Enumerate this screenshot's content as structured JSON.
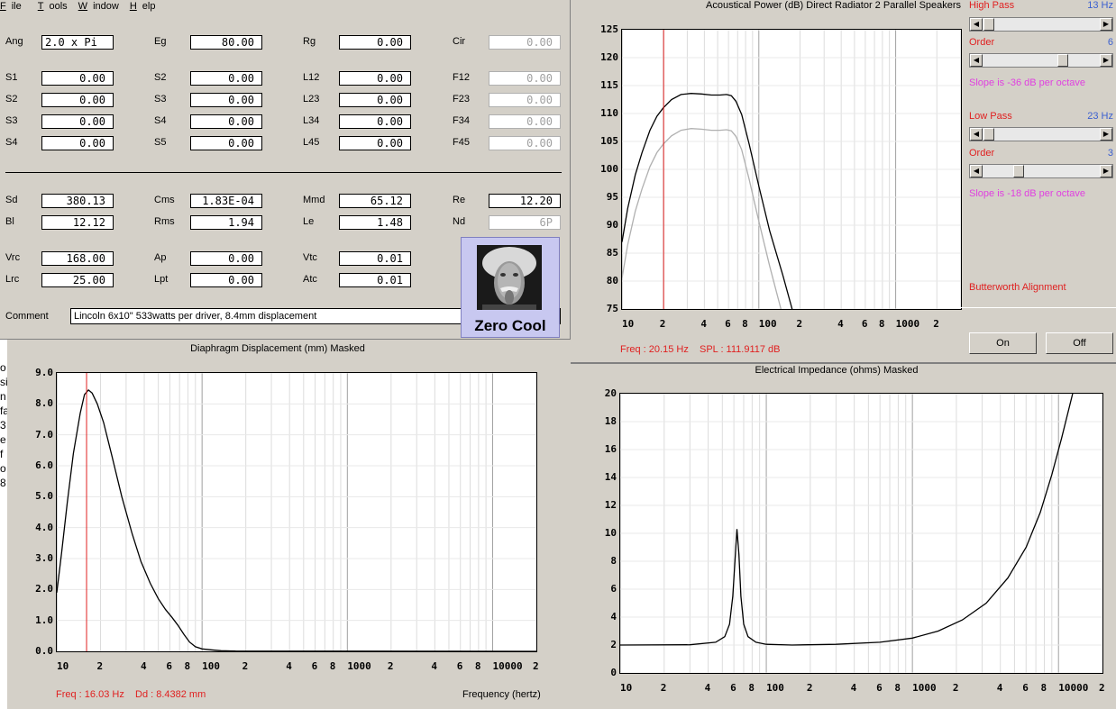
{
  "menu": [
    "File",
    "Tools",
    "Window",
    "Help"
  ],
  "params": {
    "ang": {
      "label": "Ang",
      "value": "2.0 x Pi"
    },
    "eg": {
      "label": "Eg",
      "value": "80.00"
    },
    "rg": {
      "label": "Rg",
      "value": "0.00"
    },
    "cir": {
      "label": "Cir",
      "value": "0.00"
    },
    "s1a": {
      "label": "S1",
      "value": "0.00"
    },
    "s2a": {
      "label": "S2",
      "value": "0.00"
    },
    "l12": {
      "label": "L12",
      "value": "0.00"
    },
    "f12": {
      "label": "F12",
      "value": "0.00"
    },
    "s2b": {
      "label": "S2",
      "value": "0.00"
    },
    "s3a": {
      "label": "S3",
      "value": "0.00"
    },
    "l23": {
      "label": "L23",
      "value": "0.00"
    },
    "f23": {
      "label": "F23",
      "value": "0.00"
    },
    "s3b": {
      "label": "S3",
      "value": "0.00"
    },
    "s4a": {
      "label": "S4",
      "value": "0.00"
    },
    "l34": {
      "label": "L34",
      "value": "0.00"
    },
    "f34": {
      "label": "F34",
      "value": "0.00"
    },
    "s4b": {
      "label": "S4",
      "value": "0.00"
    },
    "s5a": {
      "label": "S5",
      "value": "0.00"
    },
    "l45": {
      "label": "L45",
      "value": "0.00"
    },
    "f45": {
      "label": "F45",
      "value": "0.00"
    },
    "sd": {
      "label": "Sd",
      "value": "380.13"
    },
    "cms": {
      "label": "Cms",
      "value": "1.83E-04"
    },
    "mmd": {
      "label": "Mmd",
      "value": "65.12"
    },
    "re": {
      "label": "Re",
      "value": "12.20"
    },
    "bl": {
      "label": "Bl",
      "value": "12.12"
    },
    "rms": {
      "label": "Rms",
      "value": "1.94"
    },
    "le": {
      "label": "Le",
      "value": "1.48"
    },
    "nd": {
      "label": "Nd",
      "value": "6P"
    },
    "vrc": {
      "label": "Vrc",
      "value": "168.00"
    },
    "ap": {
      "label": "Ap",
      "value": "0.00"
    },
    "vtc": {
      "label": "Vtc",
      "value": "0.01"
    },
    "lrc": {
      "label": "Lrc",
      "value": "25.00"
    },
    "lpt": {
      "label": "Lpt",
      "value": "0.00"
    },
    "atc": {
      "label": "Atc",
      "value": "0.01"
    },
    "comment": {
      "label": "Comment",
      "value": "Lincoln  6x10\" 533watts per driver, 8.4mm displacement"
    }
  },
  "badge": {
    "caption": "Zero Cool"
  },
  "filters": {
    "high_pass": {
      "label": "High Pass",
      "value": "13 Hz",
      "order_label": "Order",
      "order": "6",
      "slope": "Slope is -36 dB per octave"
    },
    "low_pass": {
      "label": "Low Pass",
      "value": "23 Hz",
      "order_label": "Order",
      "order": "3",
      "slope": "Slope is -18 dB per octave"
    },
    "alignment": "Butterworth Alignment",
    "on": "On",
    "off": "Off"
  },
  "colors": {
    "red": "#e02020",
    "blue": "#3a5fd0",
    "magenta": "#e040e0"
  },
  "left_partial_text": [
    "o",
    "si",
    "n",
    "fa",
    "3",
    "e",
    "f",
    "o",
    "8"
  ],
  "chart_data": [
    {
      "id": "spl",
      "type": "line",
      "title": "Acoustical Power (dB)   Direct Radiator   2 Parallel Speakers",
      "xscale": "log",
      "xlim": [
        10,
        3000
      ],
      "ylim": [
        75,
        125
      ],
      "yticks": [
        75,
        80,
        85,
        90,
        95,
        100,
        105,
        110,
        115,
        120,
        125
      ],
      "xtick_labels": [
        "10",
        "2",
        "4",
        "6",
        "8",
        "100",
        "2",
        "4",
        "6",
        "8",
        "1000",
        "2"
      ],
      "marker_x": 20.15,
      "readout": {
        "freq": "Freq : 20.15 Hz",
        "value": "SPL : 111.9117 dB"
      },
      "series": [
        {
          "color": "#000000",
          "points": [
            [
              10,
              87
            ],
            [
              11,
              93
            ],
            [
              12.5,
              99
            ],
            [
              14,
              103
            ],
            [
              16,
              107
            ],
            [
              18,
              109.5
            ],
            [
              20,
              111
            ],
            [
              23,
              112.5
            ],
            [
              27,
              113.4
            ],
            [
              32,
              113.6
            ],
            [
              38,
              113.5
            ],
            [
              45,
              113.3
            ],
            [
              52,
              113.3
            ],
            [
              58,
              113.4
            ],
            [
              63,
              113.2
            ],
            [
              68,
              112.2
            ],
            [
              75,
              109.8
            ],
            [
              85,
              104.5
            ],
            [
              100,
              97
            ],
            [
              120,
              89
            ],
            [
              150,
              81
            ],
            [
              175,
              75
            ]
          ]
        },
        {
          "color": "#b0b0b0",
          "points": [
            [
              10,
              80.5
            ],
            [
              11,
              86.5
            ],
            [
              12.5,
              92.5
            ],
            [
              14,
              96.5
            ],
            [
              16,
              100.5
            ],
            [
              18,
              103
            ],
            [
              20,
              104.5
            ],
            [
              23,
              106
            ],
            [
              27,
              107
            ],
            [
              32,
              107.3
            ],
            [
              38,
              107.2
            ],
            [
              45,
              107
            ],
            [
              52,
              107
            ],
            [
              58,
              107.1
            ],
            [
              63,
              106.9
            ],
            [
              68,
              105.9
            ],
            [
              75,
              103.5
            ],
            [
              85,
              98.2
            ],
            [
              100,
              90.7
            ],
            [
              120,
              82.7
            ],
            [
              145,
              75
            ]
          ]
        }
      ]
    },
    {
      "id": "disp",
      "type": "line",
      "title": "Diaphragm Displacement (mm)   Masked",
      "xscale": "log",
      "xlim": [
        10,
        20000
      ],
      "ylim": [
        0,
        9
      ],
      "yticks": [
        0,
        1,
        2,
        3,
        4,
        5,
        6,
        7,
        8,
        9
      ],
      "ytick_labels": [
        "0.0",
        "1.0",
        "2.0",
        "3.0",
        "4.0",
        "5.0",
        "6.0",
        "7.0",
        "8.0",
        "9.0"
      ],
      "xtick_labels": [
        "10",
        "2",
        "4",
        "6",
        "8",
        "100",
        "2",
        "4",
        "6",
        "8",
        "1000",
        "2",
        "4",
        "6",
        "8",
        "10000",
        "2"
      ],
      "xlabel": "Frequency (hertz)",
      "marker_x": 16.03,
      "readout": {
        "freq": "Freq : 16.03 Hz",
        "value": "Dd : 8.4382 mm"
      },
      "series": [
        {
          "color": "#000000",
          "points": [
            [
              10,
              1.9
            ],
            [
              10.8,
              3.2
            ],
            [
              11.8,
              4.8
            ],
            [
              13,
              6.4
            ],
            [
              14.5,
              7.7
            ],
            [
              15.5,
              8.3
            ],
            [
              16.5,
              8.45
            ],
            [
              17.5,
              8.35
            ],
            [
              19,
              8.0
            ],
            [
              21,
              7.4
            ],
            [
              24,
              6.3
            ],
            [
              28,
              5.0
            ],
            [
              33,
              3.8
            ],
            [
              38,
              2.9
            ],
            [
              44,
              2.2
            ],
            [
              50,
              1.7
            ],
            [
              56,
              1.35
            ],
            [
              62,
              1.1
            ],
            [
              68,
              0.85
            ],
            [
              75,
              0.55
            ],
            [
              82,
              0.3
            ],
            [
              90,
              0.15
            ],
            [
              100,
              0.08
            ],
            [
              115,
              0.05
            ],
            [
              135,
              0.02
            ],
            [
              170,
              0.01
            ],
            [
              20000,
              0
            ]
          ]
        }
      ]
    },
    {
      "id": "imp",
      "type": "line",
      "title": "Electrical Impedance (ohms)   Masked",
      "xscale": "log",
      "xlim": [
        10,
        20000
      ],
      "ylim": [
        0,
        20
      ],
      "yticks": [
        0,
        2,
        4,
        6,
        8,
        10,
        12,
        14,
        16,
        18,
        20
      ],
      "xtick_labels": [
        "10",
        "2",
        "4",
        "6",
        "8",
        "100",
        "2",
        "4",
        "6",
        "8",
        "1000",
        "2",
        "4",
        "6",
        "8",
        "10000",
        "2"
      ],
      "series": [
        {
          "color": "#000000",
          "points": [
            [
              10,
              2.0
            ],
            [
              30,
              2.02
            ],
            [
              45,
              2.2
            ],
            [
              52,
              2.6
            ],
            [
              56,
              3.5
            ],
            [
              59,
              5.5
            ],
            [
              61,
              8.0
            ],
            [
              63,
              10.3
            ],
            [
              65,
              8.5
            ],
            [
              67,
              5.5
            ],
            [
              70,
              3.5
            ],
            [
              75,
              2.6
            ],
            [
              85,
              2.2
            ],
            [
              100,
              2.05
            ],
            [
              150,
              2.0
            ],
            [
              300,
              2.05
            ],
            [
              600,
              2.2
            ],
            [
              1000,
              2.5
            ],
            [
              1500,
              3.0
            ],
            [
              2200,
              3.8
            ],
            [
              3200,
              5.0
            ],
            [
              4500,
              6.8
            ],
            [
              6000,
              9.0
            ],
            [
              7500,
              11.5
            ],
            [
              9000,
              14.2
            ],
            [
              10500,
              16.8
            ],
            [
              12500,
              20
            ]
          ]
        }
      ]
    }
  ]
}
